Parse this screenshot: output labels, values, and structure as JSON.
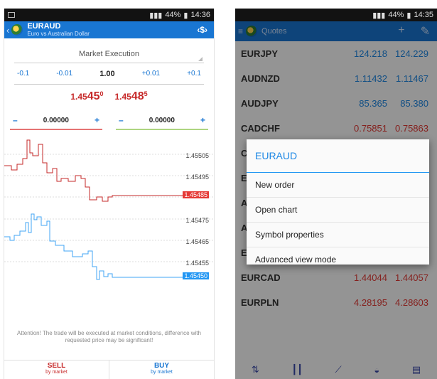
{
  "left": {
    "status": {
      "signal": "📶",
      "battery": "44%",
      "time": "14:36"
    },
    "header": {
      "symbol": "EURAUD",
      "description": "Euro vs Australian Dollar"
    },
    "execution": "Market Execution",
    "volume": {
      "minus_01": "-0.1",
      "minus_001": "-0.01",
      "value": "1.00",
      "plus_001": "+0.01",
      "plus_01": "+0.1"
    },
    "sell_price": {
      "prefix": "1.45",
      "big": "45",
      "sup": "0"
    },
    "buy_price": {
      "prefix": "1.45",
      "big": "48",
      "sup": "5"
    },
    "stop_loss": {
      "minus": "–",
      "value": "0.00000",
      "plus": "+"
    },
    "take_profit": {
      "minus": "–",
      "value": "0.00000",
      "plus": "+"
    },
    "ticks": [
      "1.45505",
      "1.45495",
      "1.45485",
      "1.45475",
      "1.45465",
      "1.45455",
      "1.45450"
    ],
    "attention": "Attention! The trade will be executed at market conditions, difference with requested price may be significant!",
    "sell_btn": {
      "label": "SELL",
      "sub": "by market"
    },
    "buy_btn": {
      "label": "BUY",
      "sub": "by market"
    }
  },
  "right": {
    "status": {
      "battery": "44%",
      "time": "14:35"
    },
    "header": {
      "title": "Quotes"
    },
    "quotes": [
      {
        "symbol": "EURJPY",
        "bid": "124.218",
        "ask": "124.229",
        "dir": "up"
      },
      {
        "symbol": "AUDNZD",
        "bid": "1.11432",
        "ask": "1.11467",
        "dir": "up"
      },
      {
        "symbol": "AUDJPY",
        "bid": "85.365",
        "ask": "85.380",
        "dir": "up"
      },
      {
        "symbol": "CADCHF",
        "bid": "0.75851",
        "ask": "0.75863",
        "dir": "down"
      },
      {
        "symbol": "C",
        "bid": "",
        "ask": "6",
        "dir": "down"
      },
      {
        "symbol": "E",
        "bid": "",
        "ask": "6",
        "dir": "down"
      },
      {
        "symbol": "A",
        "bid": "",
        "ask": "9",
        "dir": "down"
      },
      {
        "symbol": "A",
        "bid": "",
        "ask": "7",
        "dir": "down"
      },
      {
        "symbol": "E",
        "bid": "",
        "ask": "5",
        "dir": "up"
      },
      {
        "symbol": "EURCAD",
        "bid": "1.44044",
        "ask": "1.44057",
        "dir": "down"
      },
      {
        "symbol": "EURPLN",
        "bid": "4.28195",
        "ask": "4.28603",
        "dir": "down"
      }
    ],
    "dialog": {
      "title": "EURAUD",
      "items": [
        "New order",
        "Open chart",
        "Symbol properties",
        "Advanced view mode"
      ]
    },
    "nav_icons": [
      "quotes-icon",
      "chart-icon",
      "trade-icon",
      "history-icon",
      "journal-icon"
    ]
  },
  "colors": {
    "accent": "#1976d2",
    "sell": "#e53935",
    "buy": "#1e88e5"
  }
}
